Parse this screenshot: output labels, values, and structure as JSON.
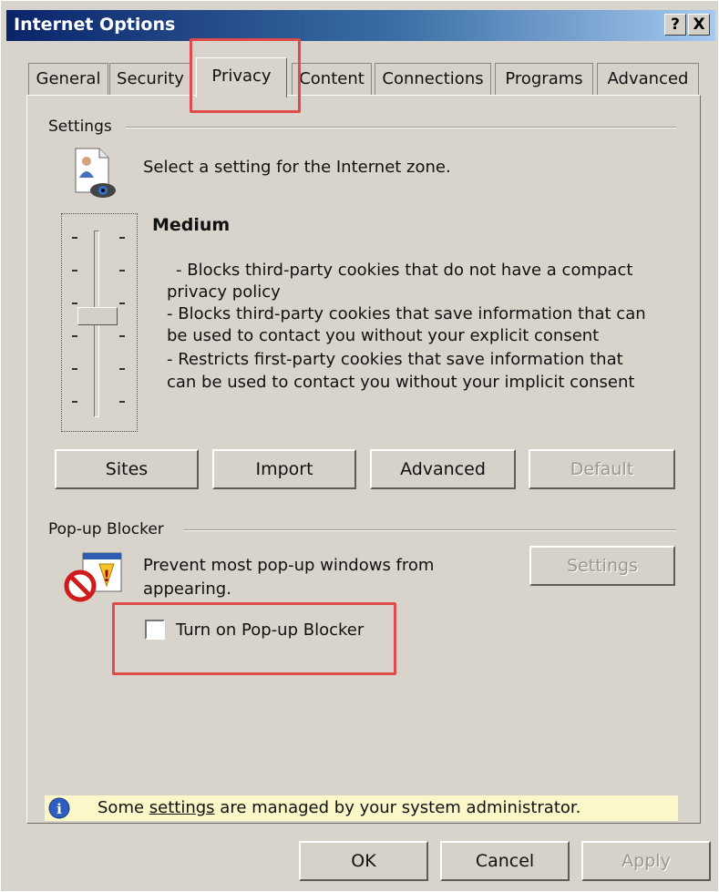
{
  "window": {
    "title": "Internet Options",
    "help_label": "?",
    "close_label": "X"
  },
  "tabs": [
    {
      "label": "General"
    },
    {
      "label": "Security"
    },
    {
      "label": "Privacy"
    },
    {
      "label": "Content"
    },
    {
      "label": "Connections"
    },
    {
      "label": "Programs"
    },
    {
      "label": "Advanced"
    }
  ],
  "settings": {
    "group_label": "Settings",
    "description": "Select a setting for the Internet zone.",
    "level_name": "Medium",
    "level_descriptions": [
      "- Blocks third-party cookies that do not have a compact",
      "privacy policy",
      "- Blocks third-party cookies that save information that can",
      "be used to contact you without your explicit consent",
      "- Restricts first-party cookies that save information that",
      "can be used to contact you without your implicit consent"
    ],
    "slider_level": 0.5,
    "buttons": {
      "sites": "Sites",
      "import": "Import",
      "advanced": "Advanced",
      "default": "Default"
    }
  },
  "popup_blocker": {
    "group_label": "Pop-up Blocker",
    "description_line1": "Prevent most pop-up windows from",
    "description_line2": "appearing.",
    "settings_button": "Settings",
    "checkbox_label": "Turn on Pop-up Blocker",
    "checkbox_checked": false
  },
  "info": {
    "prefix": "Some ",
    "link": "settings",
    "suffix": " are managed by your system administrator."
  },
  "footer_buttons": {
    "ok": "OK",
    "cancel": "Cancel",
    "apply": "Apply"
  },
  "colors": {
    "highlight_box": "#df4b4b",
    "title_bar_start": "#0a246a",
    "title_bar_end": "#a6caf0",
    "info_bar": "#fbf7c9"
  },
  "icons": {
    "privacy_zone": "privacy-zone-icon",
    "popup_blocker": "popup-blocker-icon",
    "info": "info-icon"
  }
}
